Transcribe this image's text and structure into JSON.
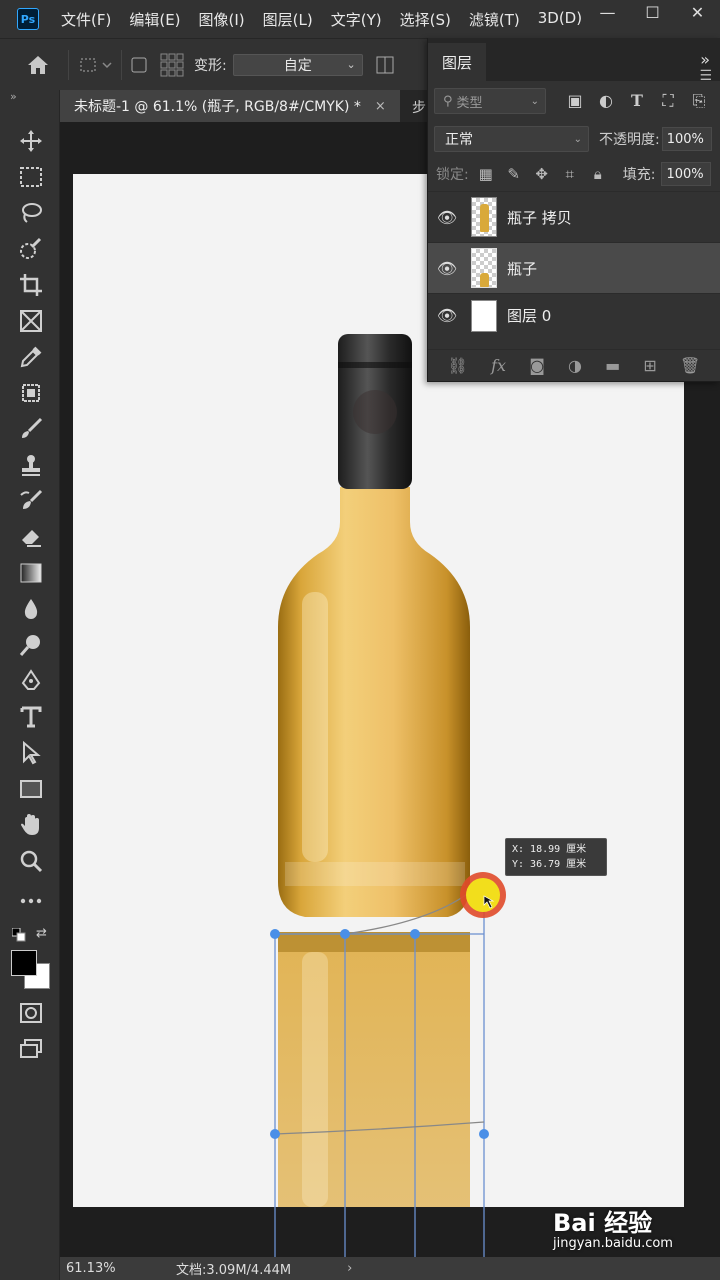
{
  "app": {
    "logo": "Ps"
  },
  "menu": [
    "文件(F)",
    "编辑(E)",
    "图像(I)",
    "图层(L)",
    "文字(Y)",
    "选择(S)",
    "滤镜(T)",
    "3D(D)"
  ],
  "window_controls": {
    "minimize": "—",
    "maximize": "☐",
    "close": "✕"
  },
  "options_bar": {
    "transform_label": "变形:",
    "transform_value": "自定"
  },
  "document_tab": {
    "title": "未标题-1 @ 61.1% (瓶子, RGB/8#/CMYK) *",
    "close": "×",
    "next_tab": "步"
  },
  "tools": [
    "move-icon",
    "marquee-icon",
    "lasso-icon",
    "quick-select-icon",
    "crop-icon",
    "frame-icon",
    "eyedropper-icon",
    "healing-icon",
    "brush-icon",
    "stamp-icon",
    "history-brush-icon",
    "eraser-icon",
    "gradient-icon",
    "blur-icon",
    "dodge-icon",
    "pen-icon",
    "type-icon",
    "path-select-icon",
    "rectangle-icon",
    "hand-icon",
    "zoom-icon",
    "more-icon"
  ],
  "colors": {
    "foreground": "#000000",
    "background": "#ffffff",
    "accent": "#31a8ff",
    "handle": "#4a8fe7"
  },
  "layers_panel": {
    "tab": "图层",
    "collapse": "»",
    "filter_kind": "类型",
    "blend_mode": "正常",
    "opacity_label": "不透明度:",
    "opacity_value": "100%",
    "lock_label": "锁定:",
    "fill_label": "填充:",
    "fill_value": "100%",
    "layers": [
      {
        "name": "瓶子 拷贝",
        "visible": true,
        "selected": false
      },
      {
        "name": "瓶子",
        "visible": true,
        "selected": true
      },
      {
        "name": "图层 0",
        "visible": true,
        "selected": false
      }
    ],
    "footer": {
      "link": "link-icon",
      "fx": "fx"
    }
  },
  "tooltip": {
    "x_line": "X:  18.99 厘米",
    "y_line": "Y:  36.79 厘米"
  },
  "status": {
    "zoom": "61.13%",
    "doc": "文档:3.09M/4.44M",
    "arrow": "›"
  },
  "watermark": {
    "logo": "Bai 经验",
    "url": "jingyan.baidu.com"
  }
}
